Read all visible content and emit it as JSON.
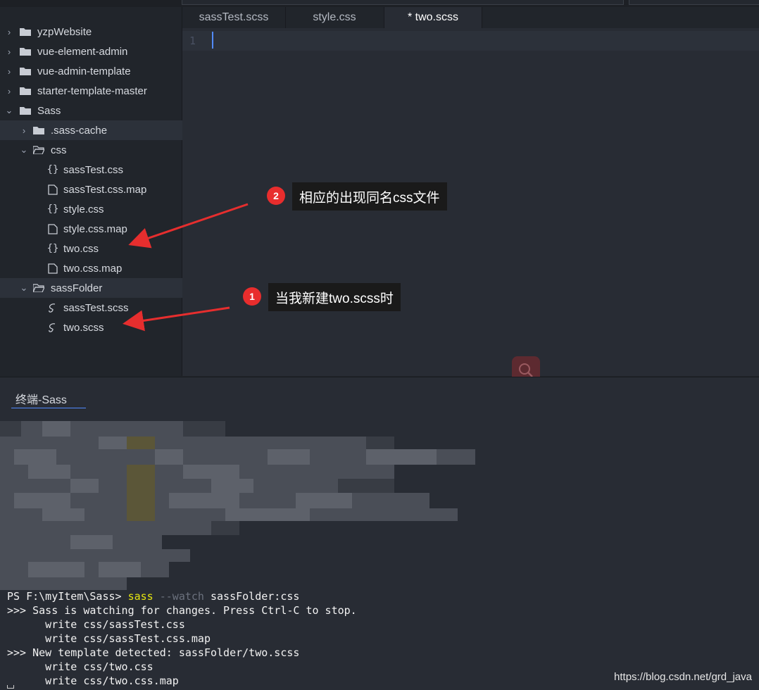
{
  "sidebar": {
    "items": [
      {
        "label": "yzpWebsite",
        "kind": "folder",
        "expanded": false
      },
      {
        "label": "vue-element-admin",
        "kind": "folder",
        "expanded": false
      },
      {
        "label": "vue-admin-template",
        "kind": "folder",
        "expanded": false
      },
      {
        "label": "starter-template-master",
        "kind": "folder",
        "expanded": false
      },
      {
        "label": "Sass",
        "kind": "folder",
        "expanded": true
      },
      {
        "label": ".sass-cache",
        "kind": "folder",
        "expanded": false
      },
      {
        "label": "css",
        "kind": "folder",
        "expanded": true
      },
      {
        "label": "sassTest.css",
        "kind": "css-file"
      },
      {
        "label": "sassTest.css.map",
        "kind": "file"
      },
      {
        "label": "style.css",
        "kind": "css-file"
      },
      {
        "label": "style.css.map",
        "kind": "file"
      },
      {
        "label": "two.css",
        "kind": "css-file"
      },
      {
        "label": "two.css.map",
        "kind": "file"
      },
      {
        "label": "sassFolder",
        "kind": "folder",
        "expanded": true
      },
      {
        "label": "sassTest.scss",
        "kind": "scss-file"
      },
      {
        "label": "two.scss",
        "kind": "scss-file"
      }
    ]
  },
  "tabs": [
    {
      "label": "sassTest.scss",
      "active": false
    },
    {
      "label": "style.css",
      "active": false
    },
    {
      "label": "* two.scss",
      "active": true
    }
  ],
  "editor": {
    "line_number": "1"
  },
  "annotations": [
    {
      "number": "2",
      "text": "相应的出现同名css文件"
    },
    {
      "number": "1",
      "text": "当我新建two.scss时"
    }
  ],
  "terminal": {
    "tab_label": "终端-Sass",
    "prompt": "PS F:\\myItem\\Sass> ",
    "cmd": "sass",
    "flag": " --watch ",
    "arg": "sassFolder:css",
    "lines": [
      ">>> Sass is watching for changes. Press Ctrl-C to stop.",
      "      write css/sassTest.css",
      "      write css/sassTest.css.map",
      ">>> New template detected: sassFolder/two.scss",
      "      write css/two.css",
      "      write css/two.css.map"
    ],
    "watermark": "https://blog.csdn.net/grd_java"
  },
  "colors": {
    "accent": "#528bff",
    "badge": "#e82d2d",
    "arrow": "#e62e2e"
  }
}
